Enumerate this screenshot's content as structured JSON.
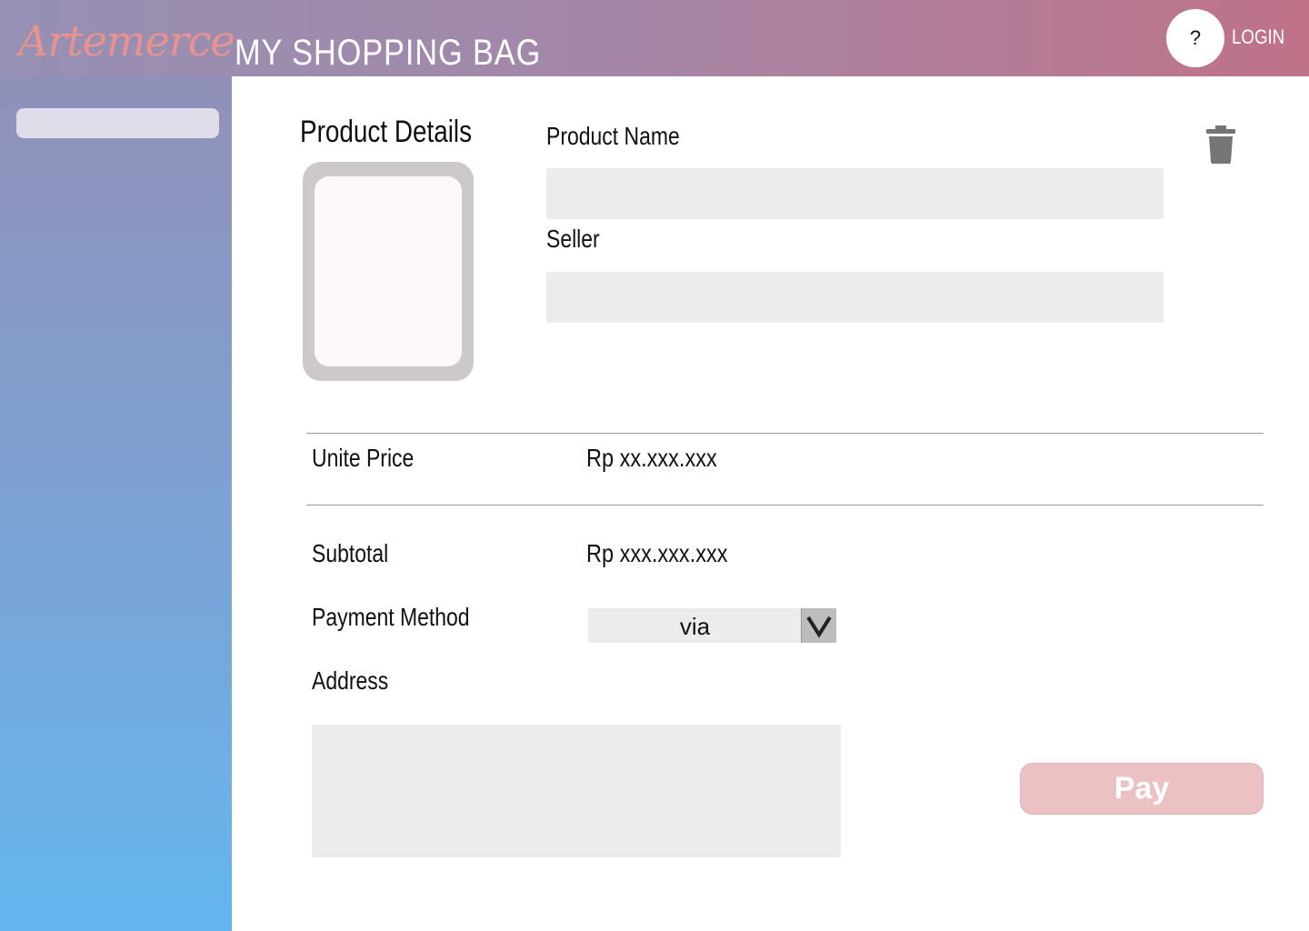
{
  "header": {
    "logo_text": "Artemerce",
    "title": "MY SHOPPING BAG",
    "help_label": "?",
    "login_label": "LOGIN"
  },
  "sidebar": {
    "search_placeholder": ""
  },
  "product": {
    "section_title": "Product Details",
    "name_label": "Product Name",
    "name_value": "",
    "seller_label": "Seller",
    "seller_value": "",
    "delete_icon": "trash-icon"
  },
  "summary": {
    "unit_price_label": "Unite Price",
    "unit_price_value": "Rp xx.xxx.xxx",
    "subtotal_label": "Subtotal",
    "subtotal_value": "Rp xxx.xxx.xxx",
    "payment_label": "Payment Method",
    "payment_selected": "via",
    "address_label": "Address",
    "address_value": ""
  },
  "actions": {
    "pay_label": "Pay"
  },
  "colors": {
    "header_start": "#9690b4",
    "header_end": "#bf7288",
    "logo": "#e8938f",
    "pay_button": "#ebc1c3",
    "field_bg": "#ececec"
  }
}
